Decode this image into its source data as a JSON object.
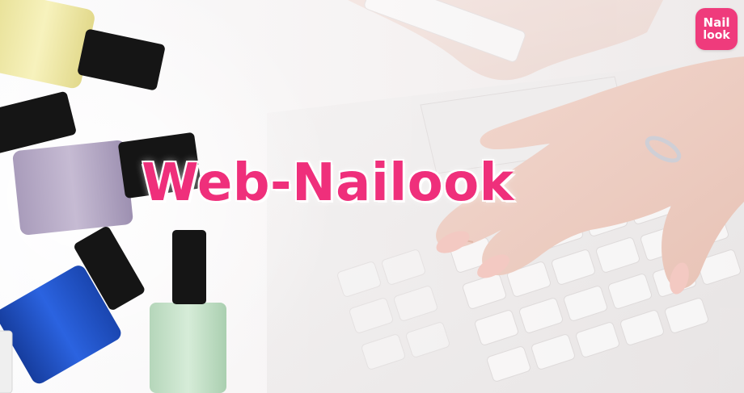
{
  "banner": {
    "title": "Web-Nailook",
    "logo": {
      "line1": "Nail",
      "line2": "look"
    }
  },
  "colors": {
    "brand_pink": "#ef2f7b",
    "logo_bg": "#ef3b7c",
    "background": "#f7f4f4",
    "bottle_yellow": "#f2ecac",
    "bottle_lavender": "#b8acc7",
    "bottle_blue": "#1f4fc6",
    "bottle_mint": "#c7e4cc",
    "cap_black": "#151515"
  },
  "icons": [
    "nailook-logo-icon",
    "nail-polish-bottle-icon",
    "keyboard-icon",
    "hand-icon"
  ]
}
